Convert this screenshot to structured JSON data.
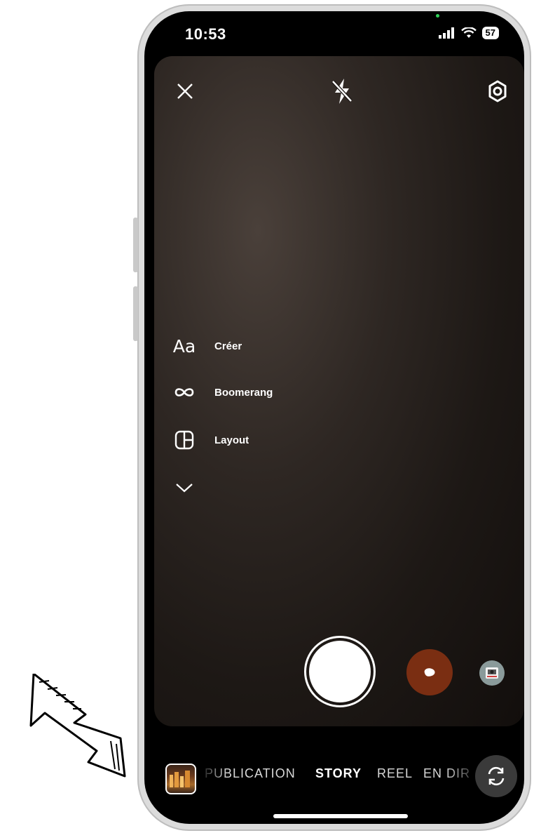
{
  "status_bar": {
    "time": "10:53",
    "battery": "57"
  },
  "top_controls": {
    "close_icon": "close-icon",
    "flash_icon": "flash-off-icon",
    "settings_icon": "settings-gear-icon"
  },
  "tools": [
    {
      "icon": "text-aa-icon",
      "icon_text": "Aa",
      "label": "Créer"
    },
    {
      "icon": "infinity-icon",
      "label": "Boomerang"
    },
    {
      "icon": "layout-grid-icon",
      "label": "Layout"
    },
    {
      "icon": "chevron-down-icon",
      "label": ""
    }
  ],
  "modes": {
    "publication": "PUBLICATION",
    "story": "STORY",
    "reel": "REEL",
    "live": "EN DIR"
  },
  "colors": {
    "effect_brown": "#7a2e12",
    "effect_polaroid": "#8a9a9a",
    "active_mode": "#ffffff",
    "inactive_mode": "#d8d8d8"
  }
}
